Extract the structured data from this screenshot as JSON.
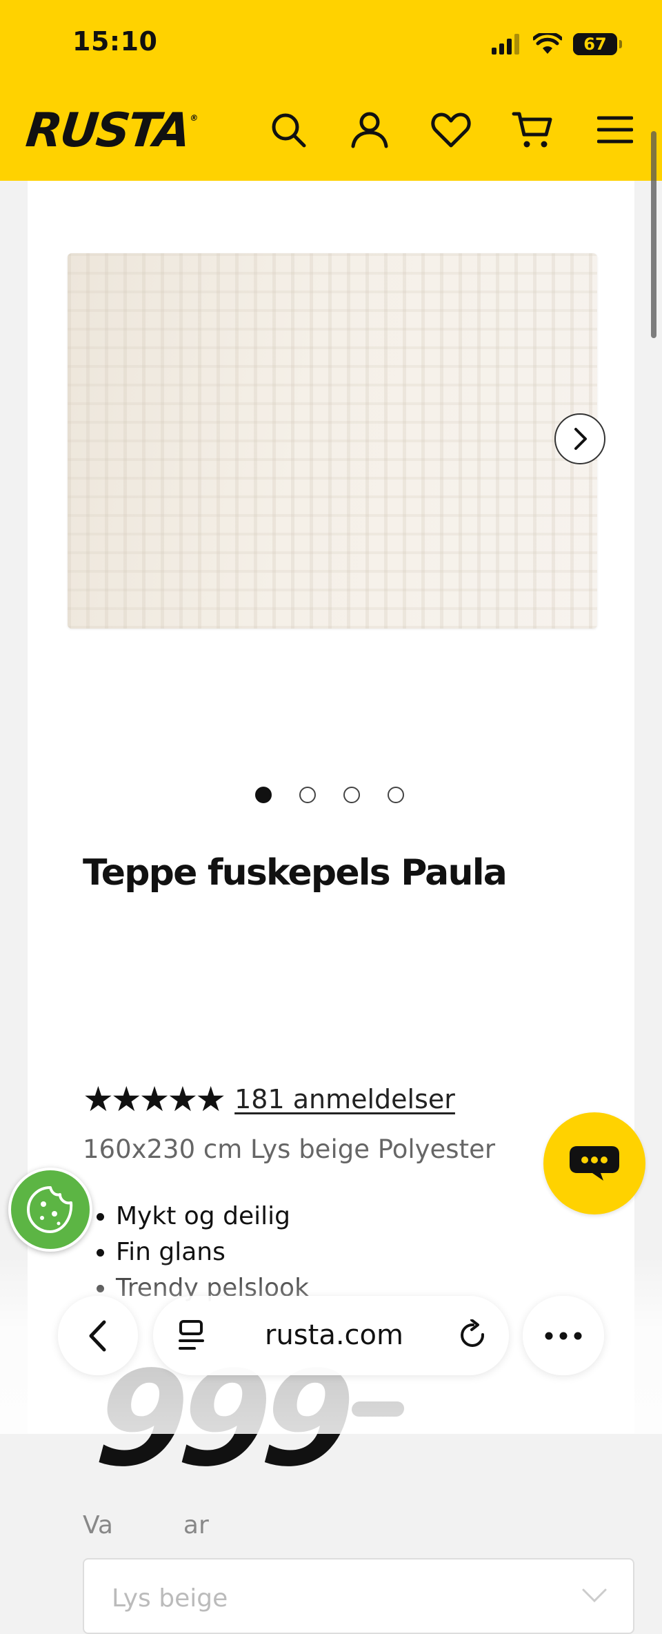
{
  "status_bar": {
    "time": "15:10",
    "battery": "67",
    "battery_level": 0.67
  },
  "header": {
    "logo": "RUSTA",
    "logo_mark": "®",
    "icons": [
      "search-icon",
      "account-icon",
      "heart-icon",
      "cart-icon",
      "menu-icon"
    ]
  },
  "gallery": {
    "slide_count": 4,
    "active_slide": 1
  },
  "product": {
    "title": "Teppe fuskepels Paula",
    "stars": "★★★★★",
    "rating": 5,
    "reviews": "181 anmeldelser",
    "subtitle": "160x230 cm Lys beige Polyester",
    "bullets": [
      "Mykt og deilig",
      "Fin glans",
      "Trendy pelslook"
    ],
    "price": "999"
  },
  "variant": {
    "label_partial": "Va",
    "label_tail": "ar",
    "selected": "Lys beige"
  },
  "browser": {
    "url": "rusta.com"
  },
  "colors": {
    "brand_yellow": "#ffd200",
    "cookie_green": "#5cb544",
    "text": "#111111"
  }
}
